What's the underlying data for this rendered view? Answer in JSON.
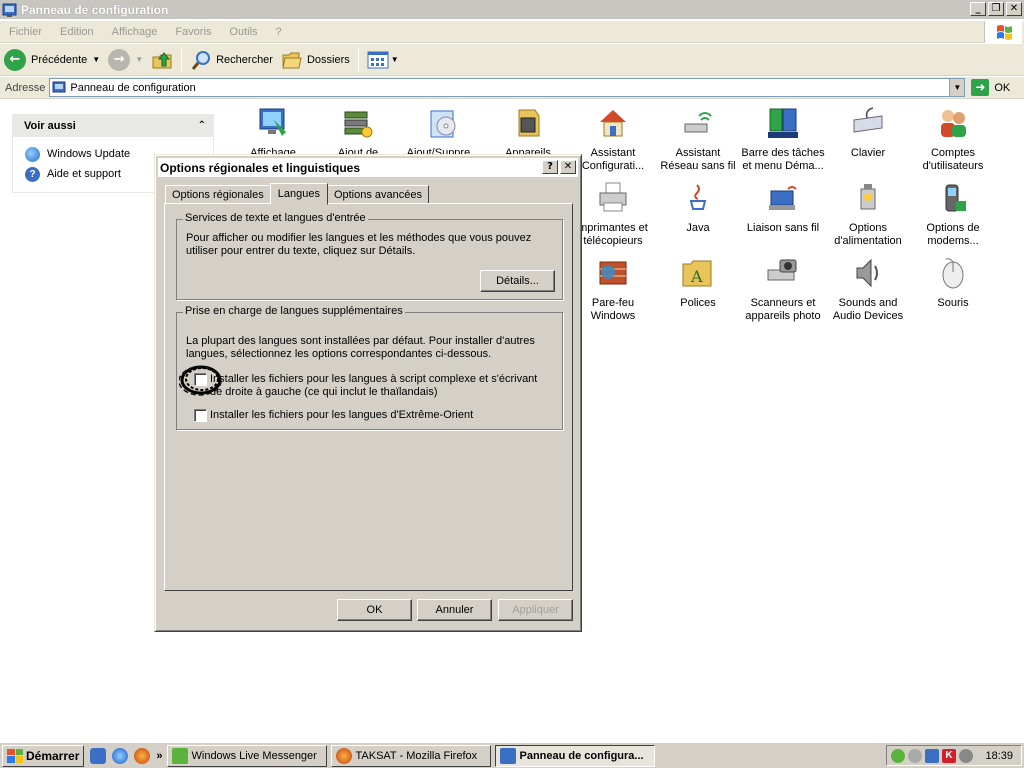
{
  "window": {
    "title": "Panneau de configuration",
    "menu": [
      "Fichier",
      "Edition",
      "Affichage",
      "Favoris",
      "Outils",
      "?"
    ]
  },
  "toolbar": {
    "back_label": "Précédente",
    "search_label": "Rechercher",
    "folders_label": "Dossiers"
  },
  "address": {
    "label": "Adresse",
    "value": "Panneau de configuration",
    "go_label": "OK"
  },
  "see_also": {
    "title": "Voir aussi",
    "items": [
      {
        "label": "Windows Update",
        "icon": "windows-update-icon"
      },
      {
        "label": "Aide et support",
        "icon": "help-icon"
      }
    ]
  },
  "control_panel": {
    "items": [
      {
        "line1": "Affichage",
        "line2": "",
        "icon": "display-icon"
      },
      {
        "line1": "Ajout de",
        "line2": "",
        "icon": "add-hardware-icon"
      },
      {
        "line1": "Ajout/Suppre...",
        "line2": "",
        "icon": "add-remove-programs-icon"
      },
      {
        "line1": "Appareils",
        "line2": "",
        "icon": "devices-icon"
      },
      {
        "line1": "Assistant",
        "line2": "Configurati...",
        "icon": "network-setup-icon"
      },
      {
        "line1": "Assistant",
        "line2": "Réseau sans fil",
        "icon": "wireless-network-icon"
      },
      {
        "line1": "Barre des tâches",
        "line2": "et menu Déma...",
        "icon": "taskbar-start-menu-icon"
      },
      {
        "line1": "Clavier",
        "line2": "",
        "icon": "keyboard-icon"
      },
      {
        "line1": "Comptes",
        "line2": "d'utilisateurs",
        "icon": "user-accounts-icon"
      },
      {
        "line1": "mprimantes et",
        "line2": "télécopieurs",
        "icon": "printers-icon"
      },
      {
        "line1": "Java",
        "line2": "",
        "icon": "java-icon"
      },
      {
        "line1": "Liaison sans fil",
        "line2": "",
        "icon": "wireless-link-icon"
      },
      {
        "line1": "Options",
        "line2": "d'alimentation",
        "icon": "power-options-icon"
      },
      {
        "line1": "Options de",
        "line2": "modems...",
        "icon": "modem-options-icon"
      },
      {
        "line1": "Pare-feu",
        "line2": "Windows",
        "icon": "firewall-icon"
      },
      {
        "line1": "Polices",
        "line2": "",
        "icon": "fonts-icon"
      },
      {
        "line1": "Scanneurs et",
        "line2": "appareils photo",
        "icon": "scanners-cameras-icon"
      },
      {
        "line1": "Sounds and",
        "line2": "Audio Devices",
        "icon": "sounds-icon"
      },
      {
        "line1": "Souris",
        "line2": "",
        "icon": "mouse-icon"
      }
    ]
  },
  "dialog": {
    "title": "Options régionales et linguistiques",
    "help_glyph": "?",
    "close_glyph": "✕",
    "tabs": [
      "Options régionales",
      "Langues",
      "Options avancées"
    ],
    "active_tab": "Langues",
    "group1": {
      "legend": "Services de texte et langues d'entrée",
      "text": "Pour afficher ou modifier les langues et les méthodes que vous pouvez utiliser pour entrer du texte, cliquez sur Détails.",
      "button": "Détails..."
    },
    "group2": {
      "legend": "Prise en charge de langues supplémentaires",
      "text": "La plupart des langues sont installées par défaut. Pour installer d'autres langues, sélectionnez les options correspondantes ci-dessous.",
      "checkbox1": "Installer les fichiers pour les langues à script complexe et s'écrivant de droite à gauche (ce qui inclut le thaïlandais)",
      "checkbox2": "Installer les fichiers pour les langues d'Extrême-Orient",
      "checkbox1_checked": false,
      "checkbox2_checked": false
    },
    "ok": "OK",
    "cancel": "Annuler",
    "apply": "Appliquer"
  },
  "taskbar": {
    "start": "Démarrer",
    "chevron": "»",
    "tasks": [
      {
        "label": "Windows Live Messenger",
        "icon": "messenger-icon",
        "active": false
      },
      {
        "label": "TAKSAT - Mozilla Firefox",
        "icon": "firefox-icon",
        "active": false
      },
      {
        "label": "Panneau de configura...",
        "icon": "control-panel-icon",
        "active": true
      }
    ],
    "clock": "18:39"
  },
  "colors": {
    "xp_grey": "#d4d0c8",
    "explorer_bar": "#ece9d8",
    "go_green": "#2fa34a",
    "link_blue": "#0a246a"
  }
}
